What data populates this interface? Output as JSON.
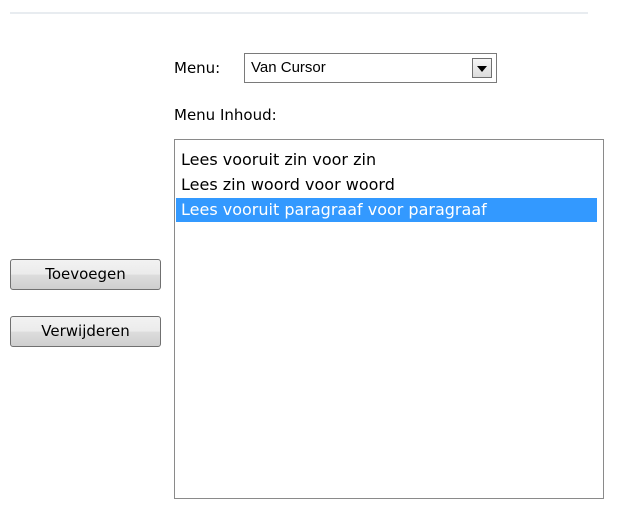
{
  "menu": {
    "label": "Menu:",
    "selected_value": "Van Cursor",
    "dropdown_icon": "chevron-down-icon"
  },
  "content": {
    "label": "Menu Inhoud:",
    "items": [
      {
        "label": "Lees vooruit zin voor zin",
        "selected": false
      },
      {
        "label": "Lees zin woord voor woord",
        "selected": false
      },
      {
        "label": "Lees vooruit paragraaf voor paragraaf",
        "selected": true
      }
    ]
  },
  "buttons": {
    "add_label": "Toevoegen",
    "remove_label": "Verwijderen"
  },
  "colors": {
    "selection_bg": "#3399ff",
    "selection_text": "#ffffff",
    "divider": "#e8ecf0"
  }
}
